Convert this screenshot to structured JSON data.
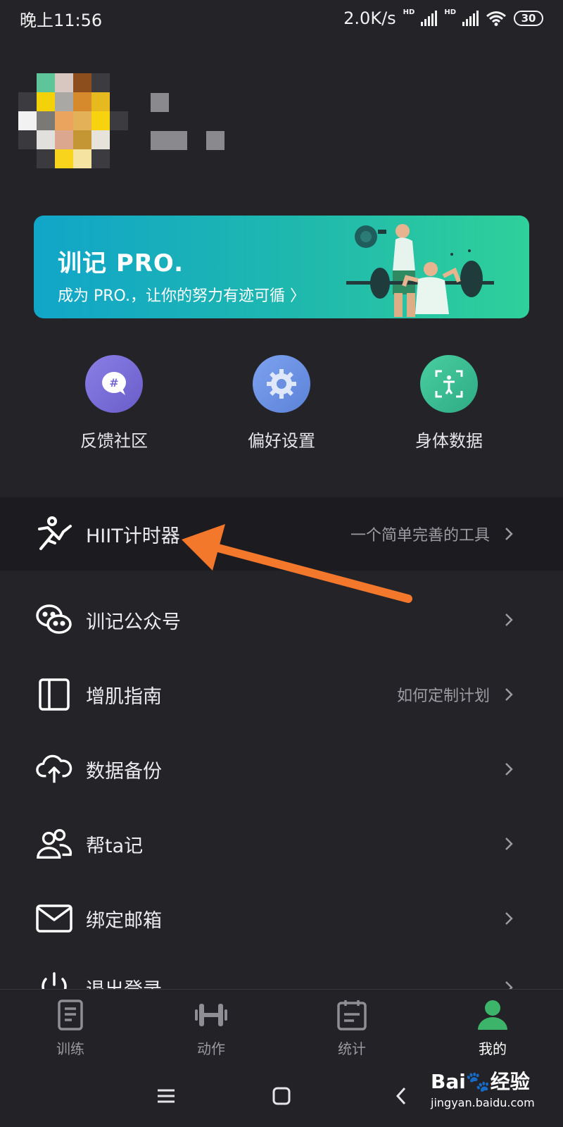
{
  "status_bar": {
    "time": "晚上11:56",
    "net_speed": "2.0K/s",
    "hd_label": "HD",
    "battery": "30"
  },
  "pro_banner": {
    "title": "训记 PRO.",
    "subtitle": "成为 PRO.，让你的努力有迹可循 〉"
  },
  "shortcuts": [
    {
      "label": "反馈社区",
      "icon": "community-icon",
      "color": "#7b6fd8"
    },
    {
      "label": "偏好设置",
      "icon": "gear-icon",
      "color": "#6a8ee0"
    },
    {
      "label": "身体数据",
      "icon": "body-scan-icon",
      "color": "#3bbf94"
    }
  ],
  "menu": [
    {
      "label": "HIIT计时器",
      "hint": "一个简单完善的工具",
      "icon": "running-person-icon"
    },
    {
      "label": "训记公众号",
      "hint": "",
      "icon": "wechat-icon"
    },
    {
      "label": "增肌指南",
      "hint": "如何定制计划",
      "icon": "book-icon"
    },
    {
      "label": "数据备份",
      "hint": "",
      "icon": "cloud-upload-icon"
    },
    {
      "label": "帮ta记",
      "hint": "",
      "icon": "users-icon"
    },
    {
      "label": "绑定邮箱",
      "hint": "",
      "icon": "mail-icon"
    },
    {
      "label": "退出登录",
      "hint": "",
      "icon": "logout-icon"
    }
  ],
  "tabs": [
    {
      "label": "训练",
      "icon": "notebook-icon"
    },
    {
      "label": "动作",
      "icon": "dumbbell-icon"
    },
    {
      "label": "统计",
      "icon": "clipboard-icon"
    },
    {
      "label": "我的",
      "icon": "person-icon",
      "active": true
    }
  ],
  "watermark": {
    "brand": "Bai🐾经验",
    "url": "jingyan.baidu.com"
  },
  "colors": {
    "background": "#242328",
    "accent_green": "#3cb46a",
    "arrow_orange": "#f3782b"
  }
}
